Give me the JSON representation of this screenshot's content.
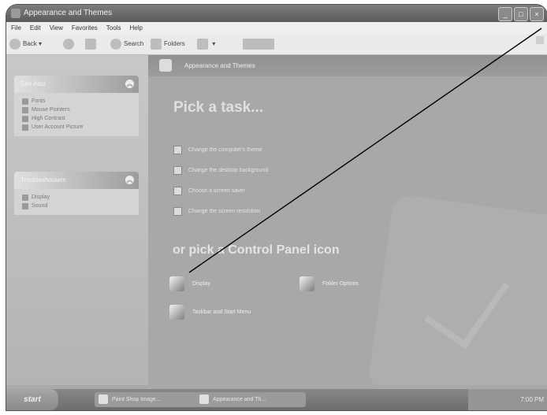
{
  "window": {
    "title": "Appearance and Themes"
  },
  "menubar": [
    "File",
    "Edit",
    "View",
    "Favorites",
    "Tools",
    "Help"
  ],
  "toolbar": {
    "back": "Back",
    "search": "Search",
    "folders": "Folders"
  },
  "sidebar": {
    "see_also": {
      "title": "See Also",
      "items": [
        "Fonts",
        "Mouse Pointers",
        "High Contrast",
        "User Account Picture"
      ]
    },
    "troubleshooters": {
      "title": "Troubleshooters",
      "items": [
        "Display",
        "Sound"
      ]
    }
  },
  "content": {
    "header": "Appearance and Themes",
    "pick_task": "Pick a task...",
    "tasks": [
      "Change the computer's theme",
      "Change the desktop background",
      "Choose a screen saver",
      "Change the screen resolution"
    ],
    "or_pick": "or pick a Control Panel icon",
    "icons": [
      "Display",
      "Folder Options",
      "Taskbar and Start Menu"
    ]
  },
  "taskbar": {
    "start": "start",
    "buttons": [
      "Paint Shop Image...",
      "Appearance and Th..."
    ],
    "tray_text": "7:00 PM"
  }
}
